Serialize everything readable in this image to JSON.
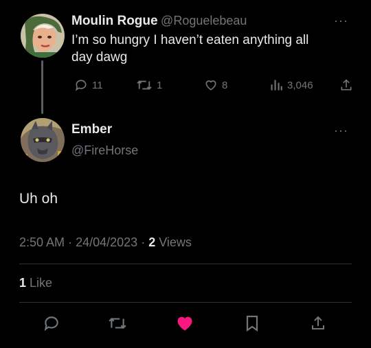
{
  "parent_tweet": {
    "display_name": "Moulin Rogue",
    "handle": "@Roguelebeau",
    "text_line1": "I’m so hungry I haven’t eaten anything all",
    "text_line2": "day dawg",
    "more": "···",
    "actions": {
      "replies": "11",
      "retweets": "1",
      "likes": "8",
      "views": "3,046"
    }
  },
  "main_tweet": {
    "display_name": "Ember",
    "handle": "@FireHorse",
    "more": "···",
    "text": "Uh oh",
    "time": "2:50 AM",
    "sep1": "·",
    "date": "24/04/2023",
    "sep2": "·",
    "views_count": "2",
    "views_label": "Views",
    "like_count": "1",
    "like_label": "Like"
  },
  "colors": {
    "background": "#000000",
    "text": "#e7e9ea",
    "muted": "#71767b",
    "like_active": "#f91880"
  },
  "icons": [
    "reply-icon",
    "retweet-icon",
    "heart-icon",
    "views-icon",
    "share-icon",
    "bookmark-icon"
  ]
}
